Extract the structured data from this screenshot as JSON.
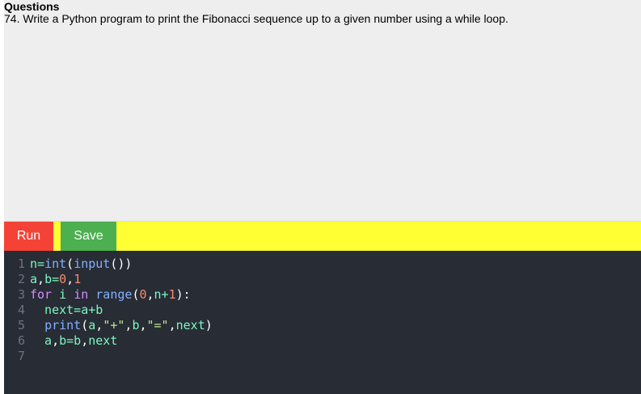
{
  "question": {
    "heading": "Questions",
    "text": "74. Write a Python program to print the Fibonacci sequence up to a given number using a while loop."
  },
  "toolbar": {
    "run_label": "Run",
    "save_label": "Save",
    "run_color": "#f44336",
    "save_color": "#4caf50",
    "bar_color": "#ffff33"
  },
  "editor": {
    "background": "#272c35",
    "lines": [
      {
        "number": "1",
        "code": "n=int(input())"
      },
      {
        "number": "2",
        "code": "a,b=0,1"
      },
      {
        "number": "3",
        "code": "for i in range(0,n+1):"
      },
      {
        "number": "4",
        "code": "  next=a+b"
      },
      {
        "number": "5",
        "code": "  print(a,\"+\",b,\"=\",next)"
      },
      {
        "number": "6",
        "code": "  a,b=b,next"
      },
      {
        "number": "7",
        "code": ""
      }
    ]
  }
}
